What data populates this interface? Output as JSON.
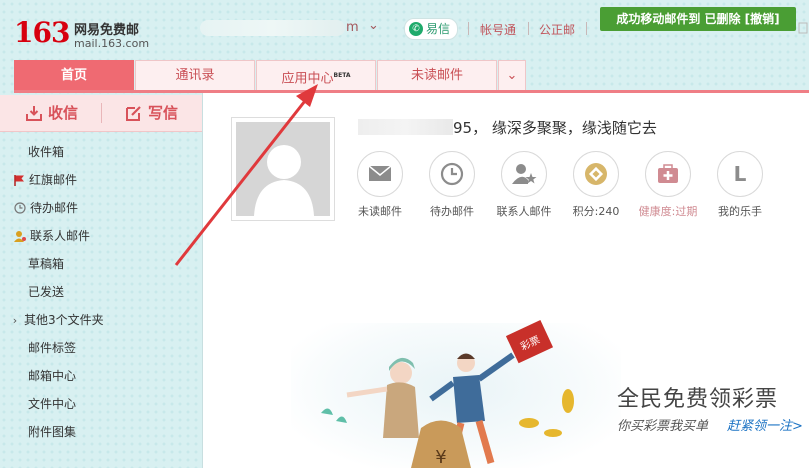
{
  "header": {
    "logo_number": "163",
    "logo_name": "网易免费邮",
    "logo_domain": "mail.163.com",
    "user_tail": "m",
    "yixin_label": "易信",
    "links": [
      "帐号通",
      "公正邮"
    ],
    "notice_text": "成功移动邮件到 已删除 [撤销]"
  },
  "tabs": [
    {
      "label": "首页",
      "active": true
    },
    {
      "label": "通讯录"
    },
    {
      "label": "应用中心",
      "badge": "BETA"
    },
    {
      "label": "未读邮件"
    }
  ],
  "sidebar": {
    "receive_label": "收信",
    "compose_label": "写信",
    "folders": [
      {
        "label": "收件箱",
        "icon": ""
      },
      {
        "label": "红旗邮件",
        "icon": "red-flag-icon"
      },
      {
        "label": "待办邮件",
        "icon": "clock-icon"
      },
      {
        "label": "联系人邮件",
        "icon": "contact-icon"
      },
      {
        "label": "草稿箱",
        "icon": ""
      },
      {
        "label": "已发送",
        "icon": ""
      },
      {
        "label": "其他3个文件夹",
        "icon": "chevron-right-icon"
      },
      {
        "label": "邮件标签",
        "icon": ""
      },
      {
        "label": "邮箱中心",
        "icon": ""
      },
      {
        "label": "文件中心",
        "icon": ""
      },
      {
        "label": "附件图集",
        "icon": ""
      }
    ]
  },
  "main": {
    "greeting_tail": "95， 缘深多聚聚，缘浅随它去",
    "quick_items": [
      {
        "label": "未读邮件",
        "icon": "envelope-icon"
      },
      {
        "label": "待办邮件",
        "icon": "clock-icon"
      },
      {
        "label": "联系人邮件",
        "icon": "contact-star-icon"
      },
      {
        "label": "积分:240",
        "icon": "coin-icon"
      },
      {
        "label": "健康度:过期",
        "icon": "medical-kit-icon"
      },
      {
        "label": "我的乐手",
        "icon": "letter-l-icon",
        "letter": "L"
      }
    ],
    "banner": {
      "title": "全民免费领彩票",
      "subtitle": "你买彩票我买单",
      "link": "赶紧领一注>",
      "ticket_text": "彩票",
      "bag_symbol": "¥"
    }
  },
  "colors": {
    "brand_red": "#d7000f",
    "tab_active": "#ef6a72",
    "notice_green": "#4a9e34",
    "annotation_arrow": "#e0393c"
  }
}
